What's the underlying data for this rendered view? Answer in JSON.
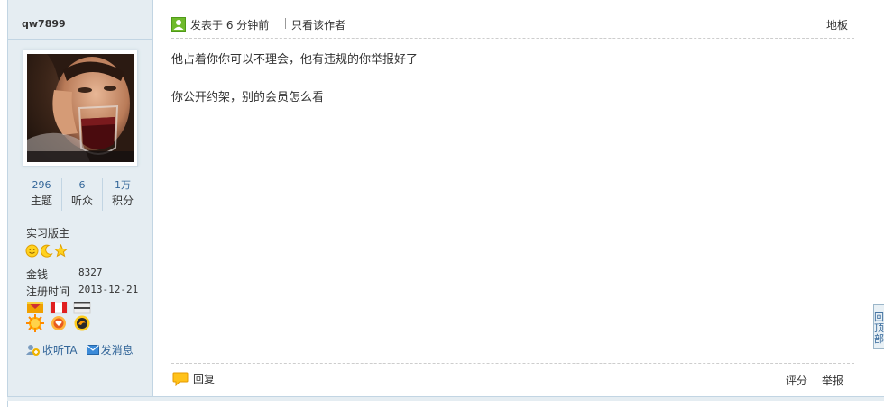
{
  "user": {
    "username": "qw7899",
    "stats": [
      {
        "value": "296",
        "label": "主题"
      },
      {
        "value": "6",
        "label": "听众"
      },
      {
        "value": "1万",
        "label": "积分"
      }
    ],
    "role": "实习版主",
    "money_label": "金钱",
    "money_value": "8327",
    "reg_label": "注册时间",
    "reg_value": "2013-12-21",
    "actions": {
      "follow": "收听TA",
      "message": "发消息"
    }
  },
  "post": {
    "posted_text": "发表于 6 分钟前",
    "only_author": "只看该作者",
    "floor": "地板",
    "lines": [
      "他占着你你可以不理会，他有违规的你举报好了",
      "你公开约架，别的会员怎么看"
    ],
    "reply_label": "回复",
    "rate_label": "评分",
    "report_label": "举报"
  },
  "back_to_top": "回顶部",
  "colors": {
    "sidebar_bg": "#e5edf2",
    "border": "#c2d5e3",
    "link": "#336699"
  }
}
